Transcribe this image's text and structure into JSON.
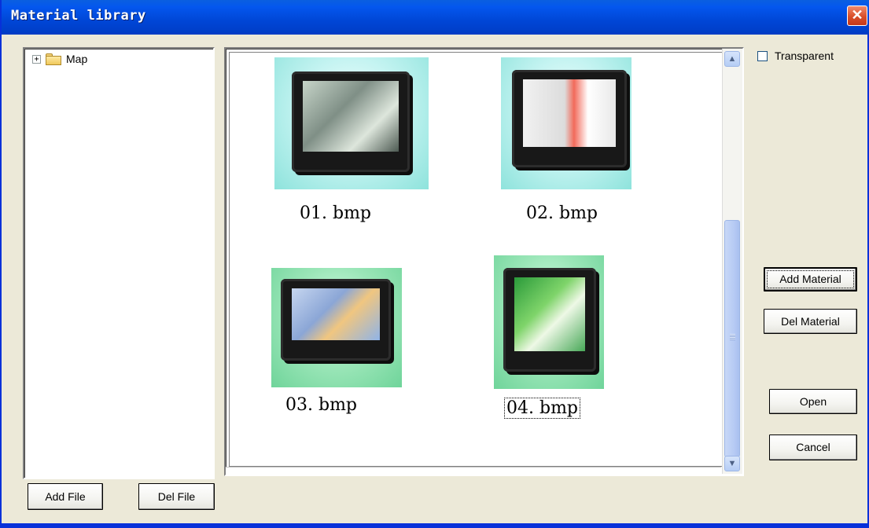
{
  "window": {
    "title": "Material library",
    "close_label": "✕"
  },
  "tree": {
    "items": [
      {
        "expander": "+",
        "label": "Map"
      }
    ]
  },
  "gallery": {
    "items": [
      {
        "name": "01. bmp"
      },
      {
        "name": "02. bmp"
      },
      {
        "name": "03. bmp"
      },
      {
        "name": "04. bmp",
        "focused": true
      }
    ]
  },
  "options": {
    "transparent_label": "Transparent",
    "transparent_checked": false
  },
  "buttons": {
    "add_material": "Add Material",
    "del_material": "Del Material",
    "open": "Open",
    "cancel": "Cancel",
    "add_file": "Add File",
    "del_file": "Del File"
  },
  "scrollbar": {
    "up_arrow": "▲",
    "down_arrow": "▼"
  },
  "colors": {
    "titlebar": "#0046d6",
    "close": "#d94f2a",
    "dialog_bg": "#ece9d8"
  }
}
